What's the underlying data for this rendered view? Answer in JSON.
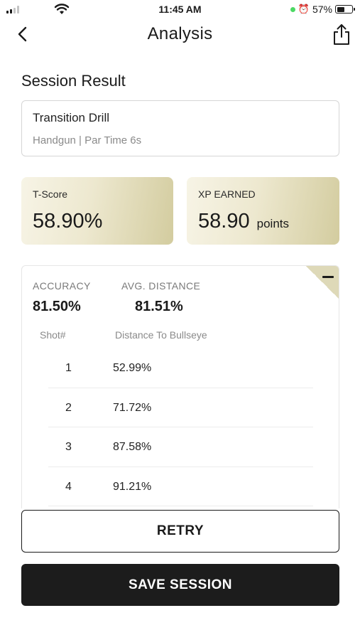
{
  "status_bar": {
    "time": "11:45 AM",
    "battery": "57%",
    "battery_level": 0.57,
    "signal_bars": 2
  },
  "nav": {
    "title": "Analysis",
    "icons": [
      "chevron-left-icon",
      "share-icon"
    ]
  },
  "session": {
    "title": "Session Result",
    "drill_name": "Transition Drill",
    "drill_details": "Handgun | Par Time 6s"
  },
  "metrics": {
    "tscore_label": "T-Score",
    "tscore_value": "58.90%",
    "xp_label": "XP EARNED",
    "xp_value": "58.90",
    "xp_unit": "points"
  },
  "analysis": {
    "accuracy_label": "ACCURACY",
    "accuracy_value": "81.50%",
    "avg_distance_label": "AVG. DISTANCE",
    "avg_distance_value": "81.51%",
    "col_shot": "Shot#",
    "col_distance": "Distance To Bullseye",
    "shots": [
      {
        "num": "1",
        "distance": "52.99%"
      },
      {
        "num": "2",
        "distance": "71.72%"
      },
      {
        "num": "3",
        "distance": "87.58%"
      },
      {
        "num": "4",
        "distance": "91.21%"
      }
    ]
  },
  "buttons": {
    "retry": "RETRY",
    "save": "SAVE SESSION"
  },
  "colors": {
    "accent_gold": "#d3cc9f",
    "primary_dark": "#1c1c1c"
  }
}
